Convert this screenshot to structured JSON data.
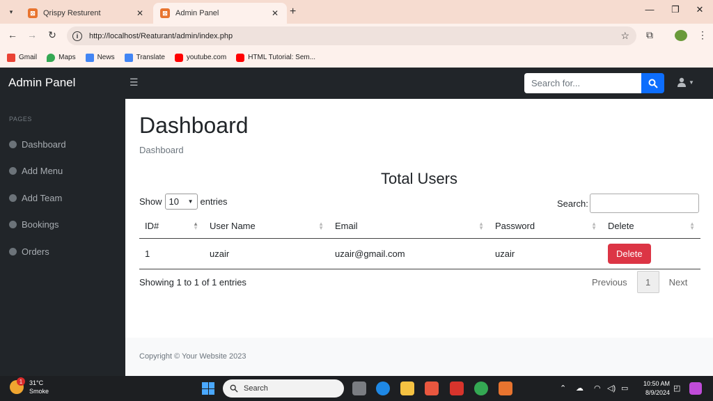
{
  "browser": {
    "tabs": [
      {
        "title": "Qrispy Resturent",
        "active": false
      },
      {
        "title": "Admin Panel",
        "active": true
      }
    ],
    "url": "http://localhost/Reaturant/admin/index.php",
    "bookmarks": [
      {
        "label": "Gmail",
        "icon": "gmail-icon",
        "color": "#ea4335"
      },
      {
        "label": "Maps",
        "icon": "maps-icon",
        "color": "#34a853"
      },
      {
        "label": "News",
        "icon": "news-icon",
        "color": "#4285f4"
      },
      {
        "label": "Translate",
        "icon": "translate-icon",
        "color": "#4285f4"
      },
      {
        "label": "youtube.com",
        "icon": "youtube-icon",
        "color": "#ff0000"
      },
      {
        "label": "HTML Tutorial: Sem...",
        "icon": "youtube-icon",
        "color": "#ff0000"
      }
    ]
  },
  "app": {
    "brand": "Admin Panel",
    "search_placeholder": "Search for...",
    "sidebar": {
      "heading": "PAGES",
      "items": [
        {
          "label": "Dashboard"
        },
        {
          "label": "Add Menu"
        },
        {
          "label": "Add Team"
        },
        {
          "label": "Bookings"
        },
        {
          "label": "Orders"
        }
      ]
    },
    "page_title": "Dashboard",
    "breadcrumb": "Dashboard",
    "section_title": "Total Users",
    "table_controls": {
      "show_label": "Show",
      "entries_value": "10",
      "entries_label": "entries",
      "search_label": "Search:"
    },
    "table": {
      "columns": [
        "ID#",
        "User Name",
        "Email",
        "Password",
        "Delete"
      ],
      "rows": [
        {
          "id": "1",
          "username": "uzair",
          "email": "uzair@gmail.com",
          "password": "uzair",
          "action": "Delete"
        }
      ]
    },
    "info": "Showing 1 to 1 of 1 entries",
    "pagination": {
      "previous": "Previous",
      "current": "1",
      "next": "Next"
    },
    "footer": "Copyright © Your Website 2023"
  },
  "taskbar": {
    "weather_temp": "31°C",
    "weather_desc": "Smoke",
    "weather_badge": "1",
    "search_label": "Search",
    "time": "10:50 AM",
    "date": "8/9/2024"
  },
  "colors": {
    "primary": "#0d6efd",
    "danger": "#dc3545",
    "dark": "#212529"
  }
}
